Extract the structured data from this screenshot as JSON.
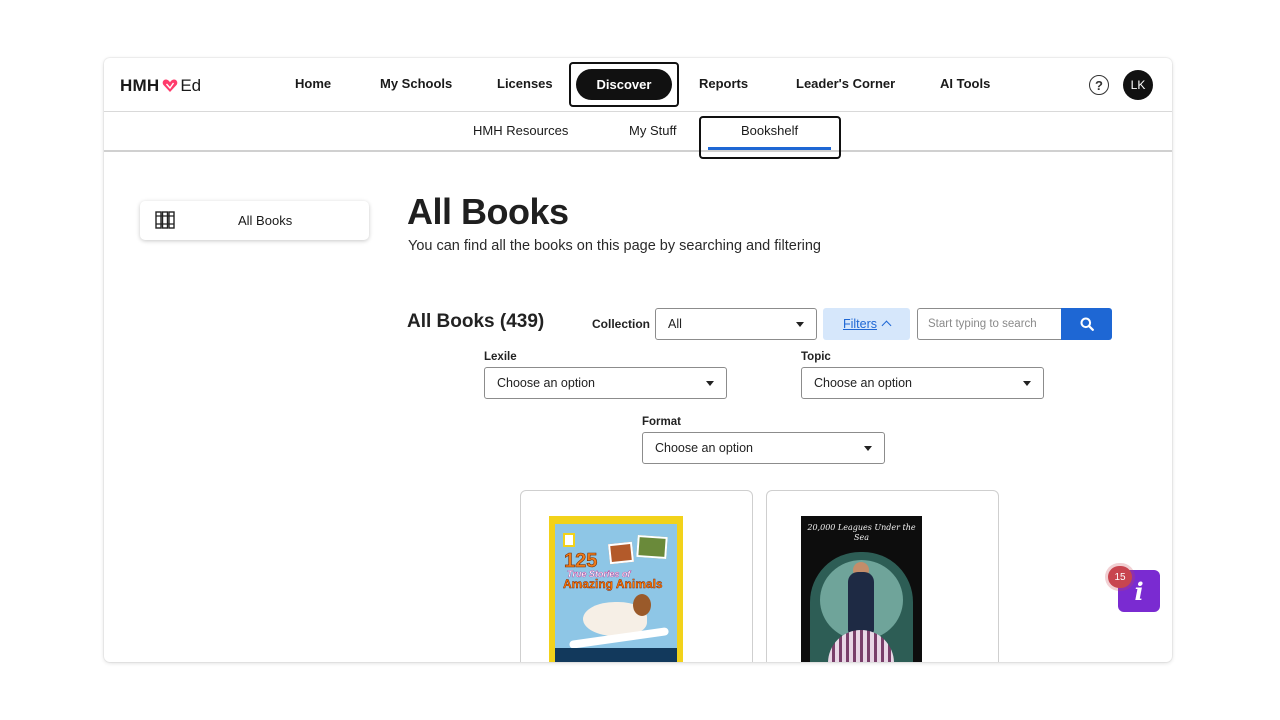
{
  "brand": {
    "logo_left": "HMH",
    "logo_right": "Ed",
    "accent": "#ff3b6b"
  },
  "nav": {
    "items": [
      {
        "label": "Home"
      },
      {
        "label": "My Schools"
      },
      {
        "label": "Licenses"
      },
      {
        "label": "Discover",
        "active": true
      },
      {
        "label": "Reports"
      },
      {
        "label": "Leader's Corner"
      },
      {
        "label": "AI Tools"
      }
    ],
    "help_icon": "question-circle-icon",
    "avatar_initials": "LK"
  },
  "subnav": {
    "items": [
      {
        "label": "HMH Resources"
      },
      {
        "label": "My Stuff"
      },
      {
        "label": "Bookshelf",
        "active": true
      }
    ],
    "active_color": "#1e67d4"
  },
  "sidebar": {
    "items": [
      {
        "label": "All Books",
        "icon": "books-icon"
      }
    ]
  },
  "main": {
    "title": "All Books",
    "subtitle": "You can find all the books on this page by searching and filtering",
    "count_title": "All Books (439)",
    "collection": {
      "label": "Collection",
      "value": "All"
    },
    "filters_label": "Filters",
    "search": {
      "placeholder": "Start typing to search",
      "icon": "search-icon"
    },
    "filters": {
      "lexile": {
        "label": "Lexile",
        "value": "Choose an option"
      },
      "topic": {
        "label": "Topic",
        "value": "Choose an option"
      },
      "format": {
        "label": "Format",
        "value": "Choose an option"
      }
    },
    "books": [
      {
        "cover_number": "125",
        "cover_line1": "True Stories of",
        "cover_line2": "Amazing Animals"
      },
      {
        "cover_title": "20,000 Leagues Under the Sea"
      }
    ]
  },
  "help_widget": {
    "badge_count": "15",
    "icon_letter": "i",
    "color": "#7a2bd1"
  }
}
